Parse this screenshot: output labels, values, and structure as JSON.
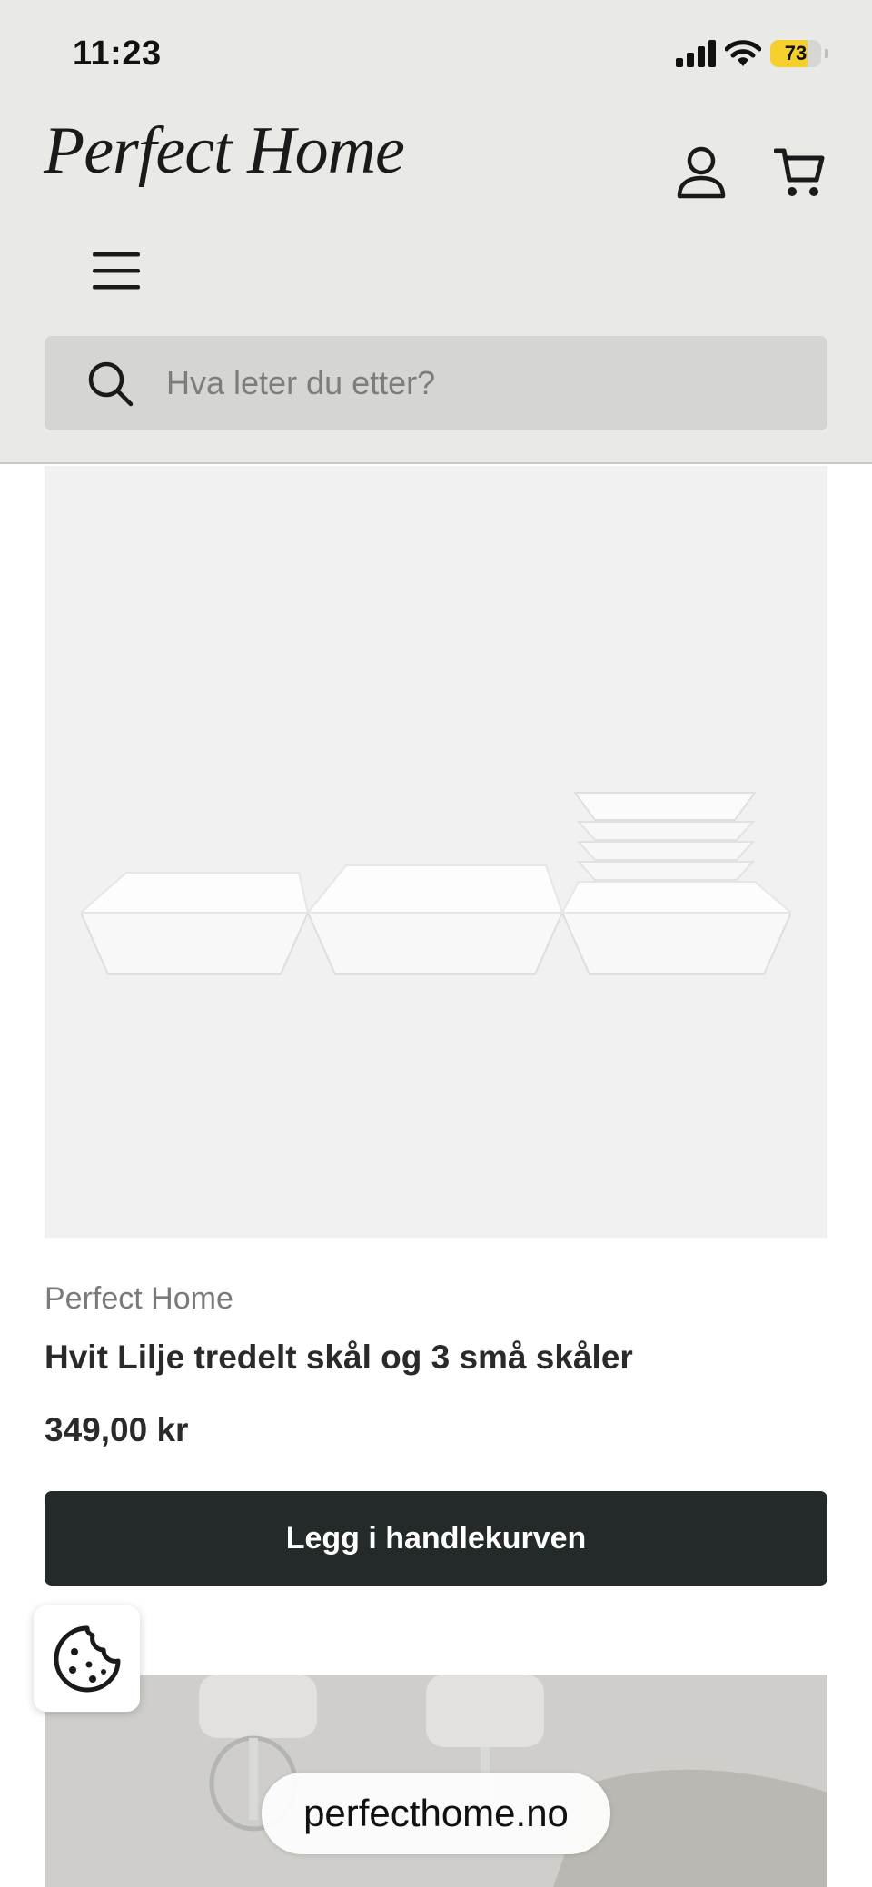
{
  "status_bar": {
    "time": "11:23",
    "battery": "73",
    "battery_level": 0.73,
    "battery_color": "#f5cf2c"
  },
  "header": {
    "logo_text": "Perfect Home",
    "background": "#e9e9e5",
    "icons": [
      "account-icon",
      "cart-icon",
      "menu-icon"
    ]
  },
  "search": {
    "placeholder": "Hva leter du etter?",
    "value": "",
    "icon": "search-icon"
  },
  "product": {
    "vendor": "Perfect Home",
    "title": "Hvit Lilje tredelt skål og 3 små skåler",
    "price": "349,00 kr",
    "add_to_cart_label": "Legg i handlekurven",
    "button_color": "#242a29"
  },
  "cookie": {
    "icon": "cookie-icon"
  },
  "browser": {
    "url": "perfecthome.no"
  }
}
